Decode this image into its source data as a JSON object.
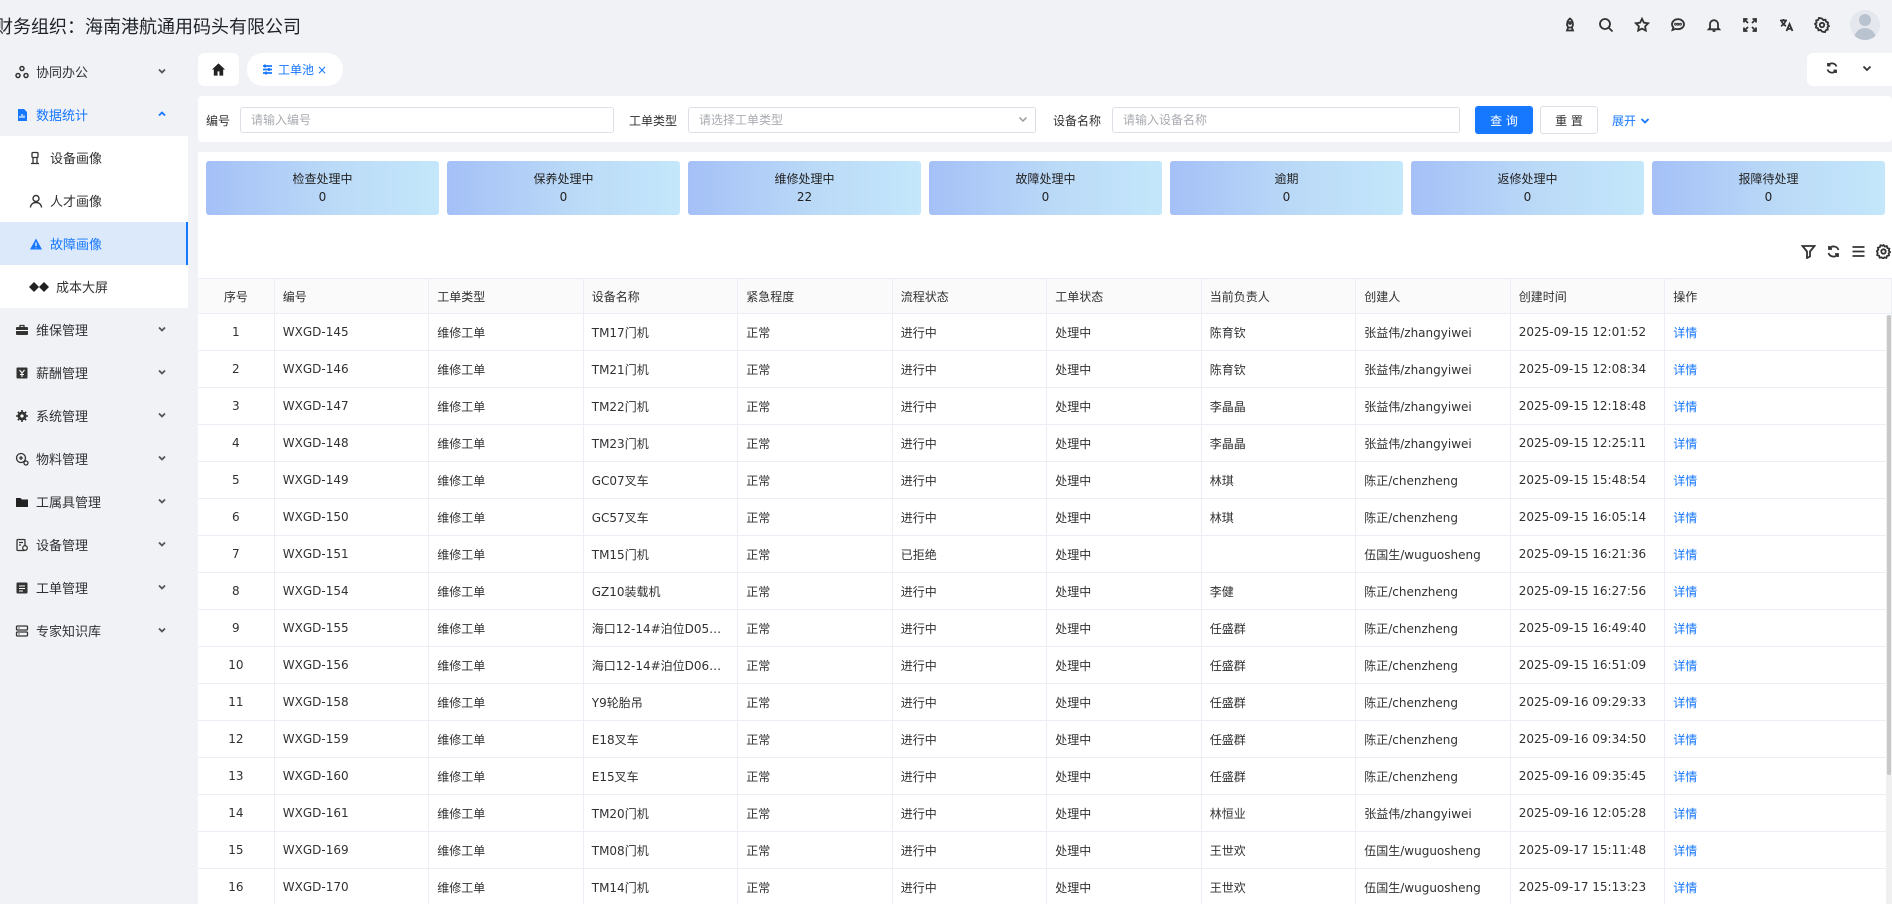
{
  "header": {
    "org_title": "财务组织：海南港航通用码头有限公司",
    "icons": [
      "rocket-icon",
      "search-icon",
      "star-icon",
      "chat-icon",
      "bell-icon",
      "fullscreen-icon",
      "translate-icon",
      "settings-icon"
    ]
  },
  "sidebar": {
    "items": [
      {
        "label": "协同办公",
        "icon": "cluster-icon"
      },
      {
        "label": "数据统计",
        "icon": "file-chart-icon"
      },
      {
        "label": "维保管理",
        "icon": "toolbox-icon"
      },
      {
        "label": "薪酬管理",
        "icon": "money-icon"
      },
      {
        "label": "系统管理",
        "icon": "gear-icon"
      },
      {
        "label": "物料管理",
        "icon": "material-icon"
      },
      {
        "label": "工属具管理",
        "icon": "folder-icon"
      },
      {
        "label": "设备管理",
        "icon": "device-icon"
      },
      {
        "label": "工单管理",
        "icon": "workorder-icon"
      },
      {
        "label": "专家知识库",
        "icon": "knowledge-icon"
      }
    ],
    "sub_items": [
      {
        "label": "设备画像"
      },
      {
        "label": "人才画像"
      },
      {
        "label": "故障画像"
      },
      {
        "label": "成本大屏"
      }
    ]
  },
  "tabs": {
    "active_label": "工单池",
    "close": "×"
  },
  "search": {
    "code_label": "编号",
    "code_placeholder": "请输入编号",
    "type_label": "工单类型",
    "type_placeholder": "请选择工单类型",
    "device_label": "设备名称",
    "device_placeholder": "请输入设备名称",
    "query_button": "查 询",
    "reset_button": "重 置",
    "expand_button": "展开"
  },
  "stats": [
    {
      "title": "检查处理中",
      "value": "0"
    },
    {
      "title": "保养处理中",
      "value": "0"
    },
    {
      "title": "维修处理中",
      "value": "22"
    },
    {
      "title": "故障处理中",
      "value": "0"
    },
    {
      "title": "逾期",
      "value": "0"
    },
    {
      "title": "返修处理中",
      "value": "0"
    },
    {
      "title": "报障待处理",
      "value": "0"
    }
  ],
  "table": {
    "columns": [
      "序号",
      "编号",
      "工单类型",
      "设备名称",
      "紧急程度",
      "流程状态",
      "工单状态",
      "当前负责人",
      "创建人",
      "创建时间",
      "操作"
    ],
    "rows": [
      [
        "1",
        "WXGD-145",
        "维修工单",
        "TM17门机",
        "正常",
        "进行中",
        "处理中",
        "陈育钦",
        "张益伟/zhangyiwei",
        "2025-09-15 12:01:52",
        "详情"
      ],
      [
        "2",
        "WXGD-146",
        "维修工单",
        "TM21门机",
        "正常",
        "进行中",
        "处理中",
        "陈育钦",
        "张益伟/zhangyiwei",
        "2025-09-15 12:08:34",
        "详情"
      ],
      [
        "3",
        "WXGD-147",
        "维修工单",
        "TM22门机",
        "正常",
        "进行中",
        "处理中",
        "李晶晶",
        "张益伟/zhangyiwei",
        "2025-09-15 12:18:48",
        "详情"
      ],
      [
        "4",
        "WXGD-148",
        "维修工单",
        "TM23门机",
        "正常",
        "进行中",
        "处理中",
        "李晶晶",
        "张益伟/zhangyiwei",
        "2025-09-15 12:25:11",
        "详情"
      ],
      [
        "5",
        "WXGD-149",
        "维修工单",
        "GC07叉车",
        "正常",
        "进行中",
        "处理中",
        "林琪",
        "陈正/chenzheng",
        "2025-09-15 15:48:54",
        "详情"
      ],
      [
        "6",
        "WXGD-150",
        "维修工单",
        "GC57叉车",
        "正常",
        "进行中",
        "处理中",
        "林琪",
        "陈正/chenzheng",
        "2025-09-15 16:05:14",
        "详情"
      ],
      [
        "7",
        "WXGD-151",
        "维修工单",
        "TM15门机",
        "正常",
        "已拒绝",
        "处理中",
        "",
        "伍国生/wuguosheng",
        "2025-09-15 16:21:36",
        "详情"
      ],
      [
        "8",
        "WXGD-154",
        "维修工单",
        "GZ10装载机",
        "正常",
        "进行中",
        "处理中",
        "李健",
        "陈正/chenzheng",
        "2025-09-15 16:27:56",
        "详情"
      ],
      [
        "9",
        "WXGD-155",
        "维修工单",
        "海口12-14#泊位D05门...",
        "正常",
        "进行中",
        "处理中",
        "任盛群",
        "陈正/chenzheng",
        "2025-09-15 16:49:40",
        "详情"
      ],
      [
        "10",
        "WXGD-156",
        "维修工单",
        "海口12-14#泊位D06门...",
        "正常",
        "进行中",
        "处理中",
        "任盛群",
        "陈正/chenzheng",
        "2025-09-15 16:51:09",
        "详情"
      ],
      [
        "11",
        "WXGD-158",
        "维修工单",
        "Y9轮胎吊",
        "正常",
        "进行中",
        "处理中",
        "任盛群",
        "陈正/chenzheng",
        "2025-09-16 09:29:33",
        "详情"
      ],
      [
        "12",
        "WXGD-159",
        "维修工单",
        "E18叉车",
        "正常",
        "进行中",
        "处理中",
        "任盛群",
        "陈正/chenzheng",
        "2025-09-16 09:34:50",
        "详情"
      ],
      [
        "13",
        "WXGD-160",
        "维修工单",
        "E15叉车",
        "正常",
        "进行中",
        "处理中",
        "任盛群",
        "陈正/chenzheng",
        "2025-09-16 09:35:45",
        "详情"
      ],
      [
        "14",
        "WXGD-161",
        "维修工单",
        "TM20门机",
        "正常",
        "进行中",
        "处理中",
        "林恒业",
        "张益伟/zhangyiwei",
        "2025-09-16 12:05:28",
        "详情"
      ],
      [
        "15",
        "WXGD-169",
        "维修工单",
        "TM08门机",
        "正常",
        "进行中",
        "处理中",
        "王世欢",
        "伍国生/wuguosheng",
        "2025-09-17 15:11:48",
        "详情"
      ],
      [
        "16",
        "WXGD-170",
        "维修工单",
        "TM14门机",
        "正常",
        "进行中",
        "处理中",
        "王世欢",
        "伍国生/wuguosheng",
        "2025-09-17 15:13:23",
        "详情"
      ]
    ]
  },
  "colors": {
    "accent": "#1677ff",
    "active_bg": "#dbe9fb",
    "page_bg": "#f0f2f5"
  }
}
